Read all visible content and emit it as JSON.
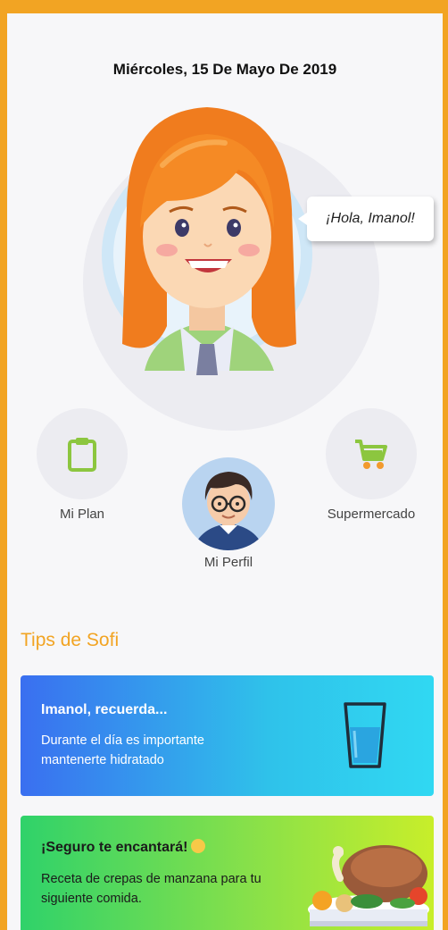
{
  "header": {
    "date": "Miércoles, 15 De Mayo De 2019"
  },
  "assistant": {
    "greeting": "¡Hola, Imanol!"
  },
  "nav": {
    "plan_label": "Mi Plan",
    "profile_label": "Mi Perfil",
    "market_label": "Supermercado"
  },
  "tips": {
    "section_title": "Tips de Sofi",
    "cards": [
      {
        "title": "Imanol, recuerda...",
        "text": "Durante el día es importante mantenerte hidratado",
        "icon": "water-glass-icon"
      },
      {
        "title": "¡Seguro te encantará!",
        "text": "Receta de crepas de manzana para tu siguiente comida.",
        "icon": "food-plate-icon"
      }
    ]
  },
  "colors": {
    "frame": "#f2a423",
    "accent": "#f2a423",
    "icon_green": "#8cc63f",
    "card1_start": "#3a6ff0",
    "card1_end": "#30d8f2",
    "card2_start": "#2fd26a",
    "card2_end": "#c8ee2a"
  }
}
